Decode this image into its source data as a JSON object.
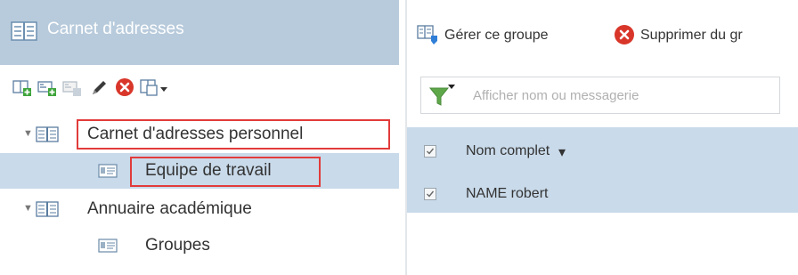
{
  "left_panel": {
    "title": "Carnet d'adresses",
    "toolbar_icons": [
      "add-contact-icon",
      "add-group-icon",
      "add-list-icon",
      "pencil-icon",
      "delete-icon",
      "more-actions-icon"
    ],
    "tree": [
      {
        "label": "Carnet d'adresses personnel",
        "expander": "▼",
        "icon": "address-book-icon"
      },
      {
        "label": "Equipe de travail",
        "icon": "group-card-icon",
        "selected": true
      },
      {
        "label": "Annuaire académique",
        "expander": "▼",
        "icon": "address-book-icon"
      },
      {
        "label": "Groupes",
        "icon": "group-card-icon"
      }
    ]
  },
  "right_panel": {
    "toolbar": {
      "manage_group_label": "Gérer ce groupe",
      "remove_from_group_label": "Supprimer du gr"
    },
    "filter": {
      "placeholder": "Afficher nom ou messagerie",
      "value": ""
    },
    "grid": {
      "column_header": "Nom complet",
      "sort_indicator": "▾",
      "rows": [
        {
          "name": "NAME robert",
          "checked": true
        }
      ]
    }
  },
  "colors": {
    "header_bg": "#b8cbdc",
    "selection_bg": "#c9daea",
    "highlight_box": "#e23b3b",
    "delete_red": "#d9362a"
  }
}
